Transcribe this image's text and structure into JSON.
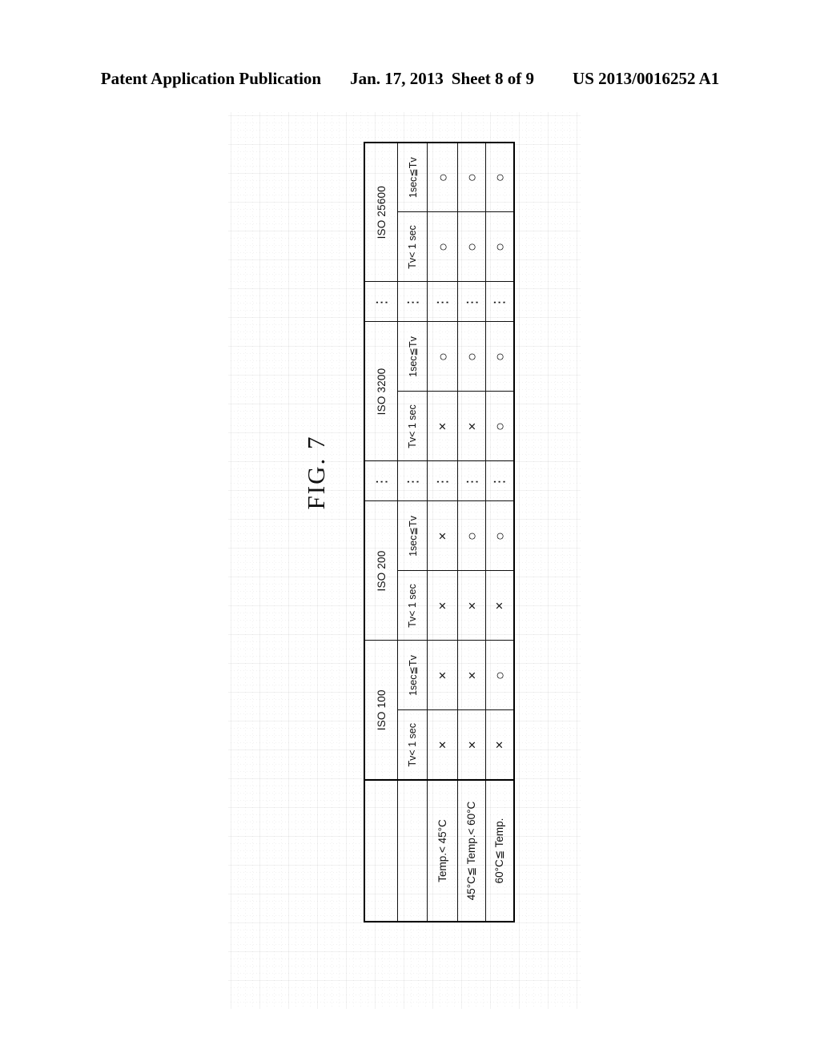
{
  "header": {
    "publication": "Patent Application Publication",
    "date": "Jan. 17, 2013",
    "sheet": "Sheet 8 of 9",
    "docnum": "US 2013/0016252 A1"
  },
  "figure": {
    "label": "FIG. 7",
    "table": {
      "corner_label": "",
      "iso_groups": [
        {
          "id": "iso100",
          "label": "ISO 100",
          "type": "group"
        },
        {
          "id": "iso200",
          "label": "ISO 200",
          "type": "group"
        },
        {
          "id": "gap1",
          "label": "⋮",
          "type": "ellipsis"
        },
        {
          "id": "iso3200",
          "label": "ISO 3200",
          "type": "group"
        },
        {
          "id": "gap2",
          "label": "⋮",
          "type": "ellipsis"
        },
        {
          "id": "iso25600",
          "label": "ISO 25600",
          "type": "group"
        }
      ],
      "tv_headers": {
        "fast": "Tv< 1 sec",
        "slow": "1sec≦Tv",
        "ellipsis": "⋮"
      },
      "row_labels": [
        "Temp.< 45°C",
        "45°C≦ Temp.< 60°C",
        "60°C≦ Temp."
      ],
      "marks": {
        "yes": "○",
        "no": "×",
        "ellipsis": "⋮"
      },
      "cells": [
        {
          "row": "Temp.< 45°C",
          "values": [
            "×",
            "×",
            "×",
            "×",
            "⋮",
            "×",
            "○",
            "⋮",
            "○",
            "○"
          ]
        },
        {
          "row": "45°C≦ Temp.< 60°C",
          "values": [
            "×",
            "×",
            "×",
            "○",
            "⋮",
            "×",
            "○",
            "⋮",
            "○",
            "○"
          ]
        },
        {
          "row": "60°C≦ Temp.",
          "values": [
            "×",
            "○",
            "×",
            "○",
            "⋮",
            "○",
            "○",
            "⋮",
            "○",
            "○"
          ]
        }
      ],
      "column_keys": [
        "ISO 100 / Tv< 1 sec",
        "ISO 100 / 1sec≦Tv",
        "ISO 200 / Tv< 1 sec",
        "ISO 200 / 1sec≦Tv",
        "⋮",
        "ISO 3200 / Tv< 1 sec",
        "ISO 3200 / 1sec≦Tv",
        "⋮",
        "ISO 25600 / Tv< 1 sec",
        "ISO 25600 / 1sec≦Tv"
      ]
    }
  }
}
